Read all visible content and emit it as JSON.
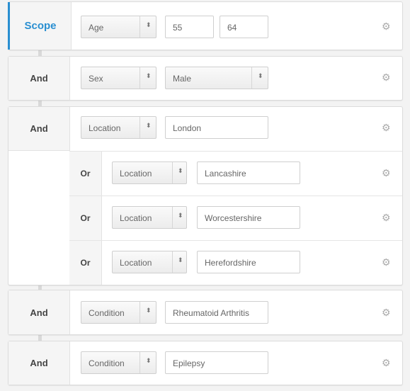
{
  "rules": [
    {
      "label": "Scope",
      "field": "Age",
      "values": [
        "55",
        "64"
      ]
    },
    {
      "label": "And",
      "field": "Sex",
      "select_value": "Male"
    },
    {
      "label": "And",
      "field": "Location",
      "values": [
        "London"
      ],
      "or": [
        {
          "label": "Or",
          "field": "Location",
          "value": "Lancashire"
        },
        {
          "label": "Or",
          "field": "Location",
          "value": "Worcestershire"
        },
        {
          "label": "Or",
          "field": "Location",
          "value": "Herefordshire"
        }
      ]
    },
    {
      "label": "And",
      "field": "Condition",
      "values": [
        "Rheumatoid Arthritis"
      ]
    },
    {
      "label": "And",
      "field": "Condition",
      "values": [
        "Epilepsy"
      ]
    }
  ],
  "icons": {
    "settings": "gear-icon",
    "dropdown": "updown-arrow-icon"
  },
  "colors": {
    "scope_accent": "#2a8fd1"
  }
}
